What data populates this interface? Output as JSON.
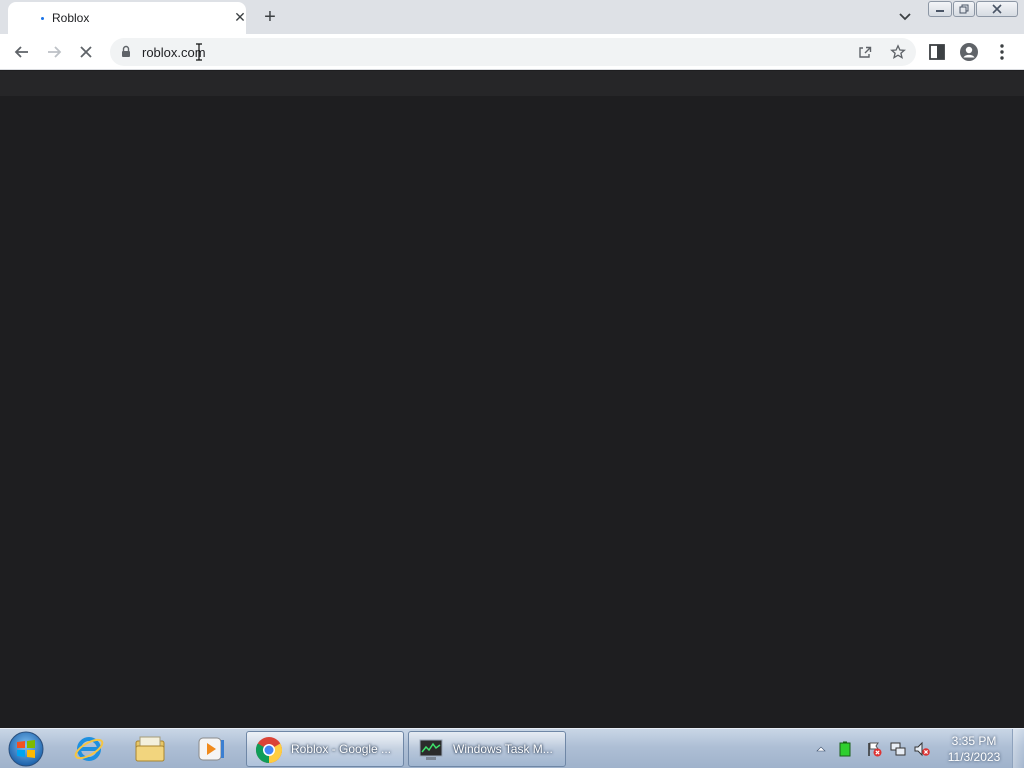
{
  "browser": {
    "tab": {
      "title": "Roblox"
    },
    "address": {
      "url": "roblox.com"
    }
  },
  "taskbar": {
    "tasks": [
      {
        "label": "Roblox - Google ..."
      },
      {
        "label": "Windows Task M..."
      }
    ],
    "clock": {
      "time": "3:35 PM",
      "date": "11/3/2023"
    }
  },
  "colors": {
    "page_background": "#1e1e20",
    "page_header": "#262628",
    "loading_accent": "#1a73e8"
  },
  "icons": {
    "pinned": [
      "internet-explorer-icon",
      "file-explorer-icon",
      "media-player-icon"
    ],
    "tray": [
      "show-hidden-icons-icon",
      "battery-icon",
      "action-center-icon",
      "network-icon",
      "volume-muted-icon"
    ]
  }
}
